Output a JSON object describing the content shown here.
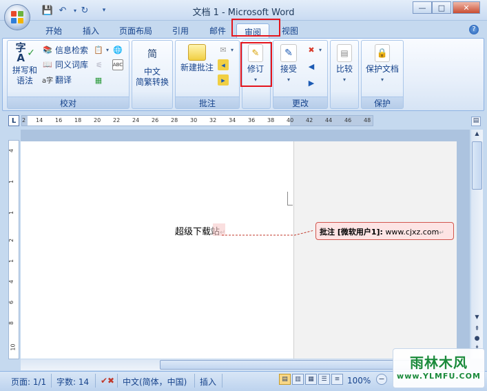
{
  "window": {
    "title": "文档 1 - Microsoft Word",
    "minimize": "—",
    "restore": "□",
    "close": "✕"
  },
  "tabs": [
    {
      "label": "开始"
    },
    {
      "label": "插入"
    },
    {
      "label": "页面布局"
    },
    {
      "label": "引用"
    },
    {
      "label": "邮件"
    },
    {
      "label": "审阅"
    },
    {
      "label": "视图"
    }
  ],
  "active_tab": "审阅",
  "ribbon": {
    "proofing": {
      "label": "校对",
      "spell_line1": "拼写和",
      "spell_line2": "语法",
      "research": "信息检索",
      "thesaurus": "同义词库",
      "translate": "翻译"
    },
    "chinese_conversion": {
      "label_line1": "中文",
      "label_line2": "简繁转换"
    },
    "comments": {
      "label": "批注",
      "new_comment": "新建批注"
    },
    "tracking": {
      "track_changes": "修订"
    },
    "changes": {
      "label": "更改",
      "accept": "接受"
    },
    "compare": {
      "compare": "比较"
    },
    "protect": {
      "label": "保护",
      "protect_doc": "保护文档"
    }
  },
  "ruler": {
    "button": "L",
    "h_ticks": [
      "2",
      "14",
      "16",
      "18",
      "20",
      "22",
      "24",
      "26",
      "28",
      "30",
      "32",
      "34",
      "36",
      "38",
      "40",
      "42",
      "44",
      "46",
      "48"
    ],
    "v_ticks": [
      "4",
      "1",
      "1",
      "2",
      "1",
      "4",
      "6",
      "8",
      "10"
    ]
  },
  "document": {
    "text": "超级下载站",
    "comment_label": "批注 [微软用户1]:",
    "comment_text": "www.cjxz.com"
  },
  "statusbar": {
    "page": "页面: 1/1",
    "words": "字数: 14",
    "language": "中文(简体，中国)",
    "mode": "插入",
    "zoom": "100%"
  },
  "watermark": {
    "line1": "雨林木风",
    "line2": "www.YLMFU.COM"
  },
  "colors": {
    "highlight_box": "#e5141b",
    "comment_border": "#d2554d",
    "comment_fill": "#fde4e4",
    "ribbon_text": "#15428b"
  }
}
